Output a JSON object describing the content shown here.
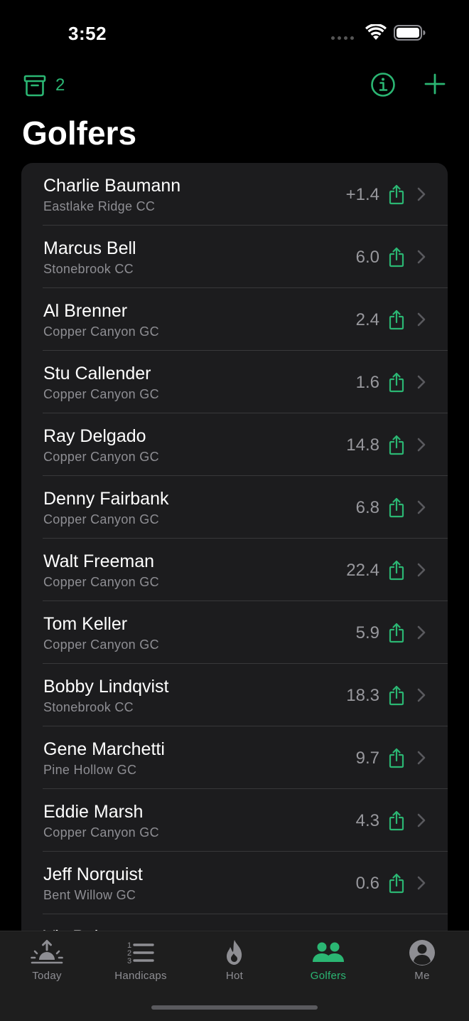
{
  "status_bar": {
    "time": "3:52"
  },
  "toolbar": {
    "archive_count": "2"
  },
  "page": {
    "title": "Golfers"
  },
  "golfers": [
    {
      "name": "Charlie Baumann",
      "club": "Eastlake Ridge CC",
      "handicap": "+1.4"
    },
    {
      "name": "Marcus Bell",
      "club": "Stonebrook CC",
      "handicap": "6.0"
    },
    {
      "name": "Al Brenner",
      "club": "Copper Canyon GC",
      "handicap": "2.4"
    },
    {
      "name": "Stu Callender",
      "club": "Copper Canyon GC",
      "handicap": "1.6"
    },
    {
      "name": "Ray Delgado",
      "club": "Copper Canyon GC",
      "handicap": "14.8"
    },
    {
      "name": "Denny Fairbank",
      "club": "Copper Canyon GC",
      "handicap": "6.8"
    },
    {
      "name": "Walt Freeman",
      "club": "Copper Canyon GC",
      "handicap": "22.4"
    },
    {
      "name": "Tom Keller",
      "club": "Copper Canyon GC",
      "handicap": "5.9"
    },
    {
      "name": "Bobby Lindqvist",
      "club": "Stonebrook CC",
      "handicap": "18.3"
    },
    {
      "name": "Gene Marchetti",
      "club": "Pine Hollow GC",
      "handicap": "9.7"
    },
    {
      "name": "Eddie Marsh",
      "club": "Copper Canyon GC",
      "handicap": "4.3"
    },
    {
      "name": "Jeff Norquist",
      "club": "Bent Willow GC",
      "handicap": "0.6"
    },
    {
      "name": "Vic Palmer",
      "club": "",
      "handicap": ""
    }
  ],
  "tab_bar": {
    "tabs": [
      {
        "label": "Today",
        "icon": "sunrise-icon"
      },
      {
        "label": "Handicaps",
        "icon": "numbered-list-icon"
      },
      {
        "label": "Hot",
        "icon": "flame-icon"
      },
      {
        "label": "Golfers",
        "icon": "people-icon"
      },
      {
        "label": "Me",
        "icon": "person-circle-icon"
      }
    ],
    "active": "Golfers"
  },
  "colors": {
    "accent": "#2bb673",
    "background": "#000000",
    "card": "#1c1c1e",
    "secondary_text": "#8e8e93"
  }
}
